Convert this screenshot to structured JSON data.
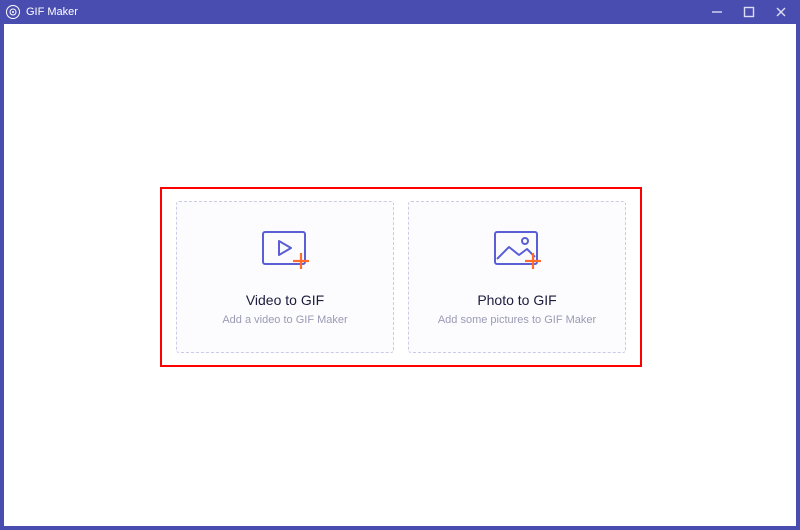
{
  "app": {
    "title": "GIF Maker"
  },
  "cards": {
    "video": {
      "title": "Video to GIF",
      "subtitle": "Add a video to GIF Maker"
    },
    "photo": {
      "title": "Photo to GIF",
      "subtitle": "Add some pictures to GIF Maker"
    }
  },
  "colors": {
    "primary": "#4a4db0",
    "iconStroke": "#5a5fd6",
    "plus": "#ff6a2b"
  }
}
